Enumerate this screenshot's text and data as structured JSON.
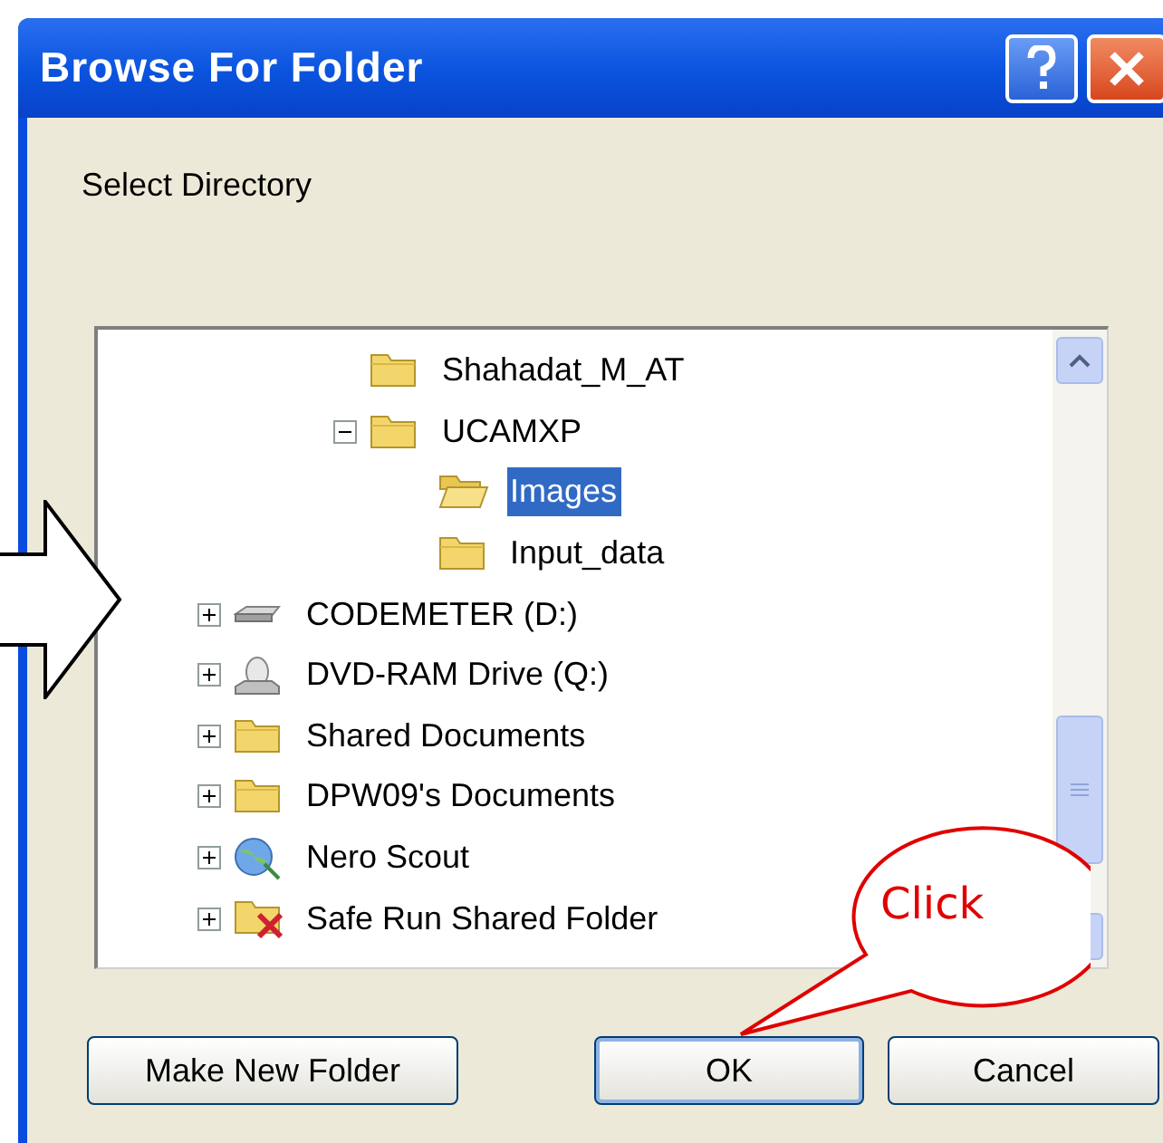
{
  "window": {
    "title": "Browse For Folder"
  },
  "prompt": "Select Directory",
  "tree": {
    "scrolled_branch": [
      {
        "label": "Shahadat_M_AT",
        "kind": "folder",
        "selected": false,
        "expandable": false
      },
      {
        "label": "UCAMXP",
        "kind": "folder",
        "selected": false,
        "expandable": true,
        "expanded": true,
        "children": [
          {
            "label": "Images",
            "kind": "open-folder",
            "selected": true,
            "expandable": false
          },
          {
            "label": "Input_data",
            "kind": "folder",
            "selected": false,
            "expandable": false
          }
        ]
      }
    ],
    "items": [
      {
        "label": "CODEMETER (D:)",
        "kind": "drive",
        "selected": false,
        "expandable": true,
        "expanded": false
      },
      {
        "label": "DVD-RAM Drive (Q:)",
        "kind": "disc-drive",
        "selected": false,
        "expandable": true,
        "expanded": false
      },
      {
        "label": "Shared Documents",
        "kind": "folder",
        "selected": false,
        "expandable": true,
        "expanded": false
      },
      {
        "label": "DPW09's Documents",
        "kind": "folder",
        "selected": false,
        "expandable": true,
        "expanded": false
      },
      {
        "label": "Nero Scout",
        "kind": "globe",
        "selected": false,
        "expandable": true,
        "expanded": false
      },
      {
        "label": "Safe Run Shared Folder",
        "kind": "shared-folder",
        "selected": false,
        "expandable": true,
        "expanded": false
      }
    ]
  },
  "buttons": [
    {
      "label": "Make New Folder",
      "default": false
    },
    {
      "label": "OK",
      "default": true
    },
    {
      "label": "Cancel",
      "default": false
    }
  ],
  "callout": {
    "text": "Click"
  }
}
